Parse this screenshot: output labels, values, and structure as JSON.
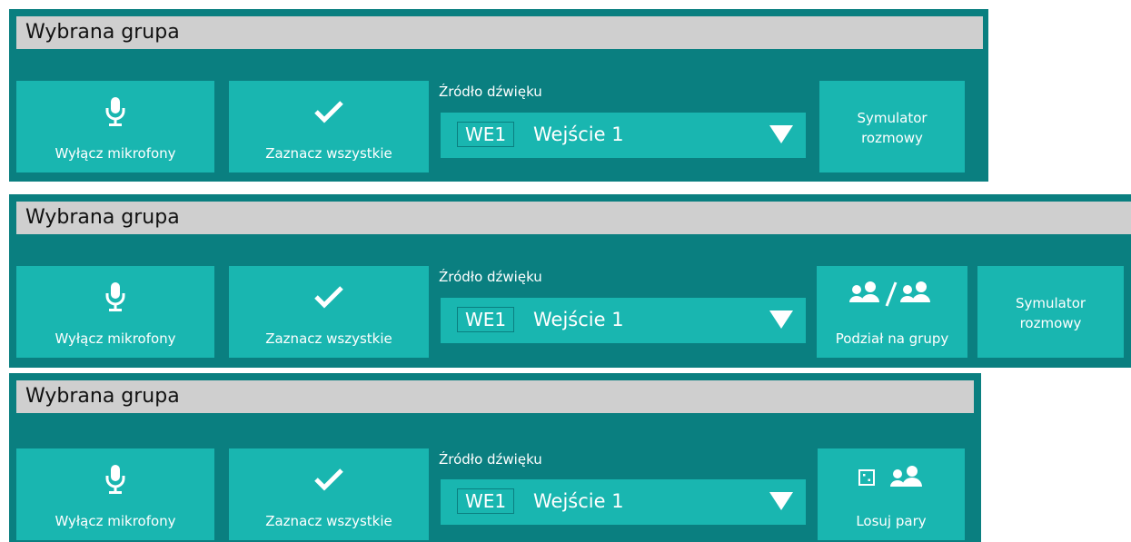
{
  "panels": [
    {
      "title": "Wybrana grupa",
      "mute_label": "Wyłącz mikrofony",
      "select_all_label": "Zaznacz wszystkie",
      "source_label": "Źródło dźwięku",
      "source_code": "WE1",
      "source_value": "Wejście 1",
      "simulator_line1": "Symulator",
      "simulator_line2": "rozmowy"
    },
    {
      "title": "Wybrana grupa",
      "mute_label": "Wyłącz mikrofony",
      "select_all_label": "Zaznacz wszystkie",
      "source_label": "Źródło dźwięku",
      "source_code": "WE1",
      "source_value": "Wejście 1",
      "split_groups_label": "Podział na grupy",
      "simulator_line1": "Symulator",
      "simulator_line2": "rozmowy"
    },
    {
      "title": "Wybrana grupa",
      "mute_label": "Wyłącz mikrofony",
      "select_all_label": "Zaznacz wszystkie",
      "source_label": "Źródło dźwięku",
      "source_code": "WE1",
      "source_value": "Wejście 1",
      "random_pairs_label": "Losuj pary"
    }
  ],
  "icons": {
    "mute": "microphone-icon",
    "select_all": "checkmark-icon",
    "dropdown": "dropdown-arrow-icon",
    "split_groups": "groups-split-icon",
    "random_pairs": "dice-icon",
    "pairs": "people-pair-icon"
  },
  "colors": {
    "panel_bg": "#0a7f80",
    "button_bg": "#19b6b0",
    "title_bg": "#cfcfcf",
    "text_light": "#ffffff"
  }
}
